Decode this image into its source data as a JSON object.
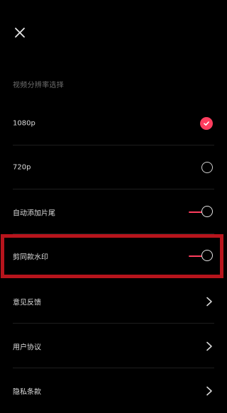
{
  "header": {
    "close_icon": "close-icon"
  },
  "resolution": {
    "title": "视频分辨率选择",
    "options": [
      {
        "label": "1080p",
        "selected": true
      },
      {
        "label": "720p",
        "selected": false
      }
    ]
  },
  "toggles": [
    {
      "label": "自动添加片尾",
      "on": true
    },
    {
      "label": "剪同款水印",
      "on": true
    }
  ],
  "links": [
    {
      "label": "意见反馈",
      "icon": "chevron-right-icon"
    },
    {
      "label": "用户协议",
      "icon": "chevron-right-icon"
    },
    {
      "label": "隐私条款",
      "icon": "chevron-right-icon"
    }
  ],
  "colors": {
    "accent": "#ff3d5e",
    "highlight_border": "#b7141c",
    "background": "#000000"
  }
}
